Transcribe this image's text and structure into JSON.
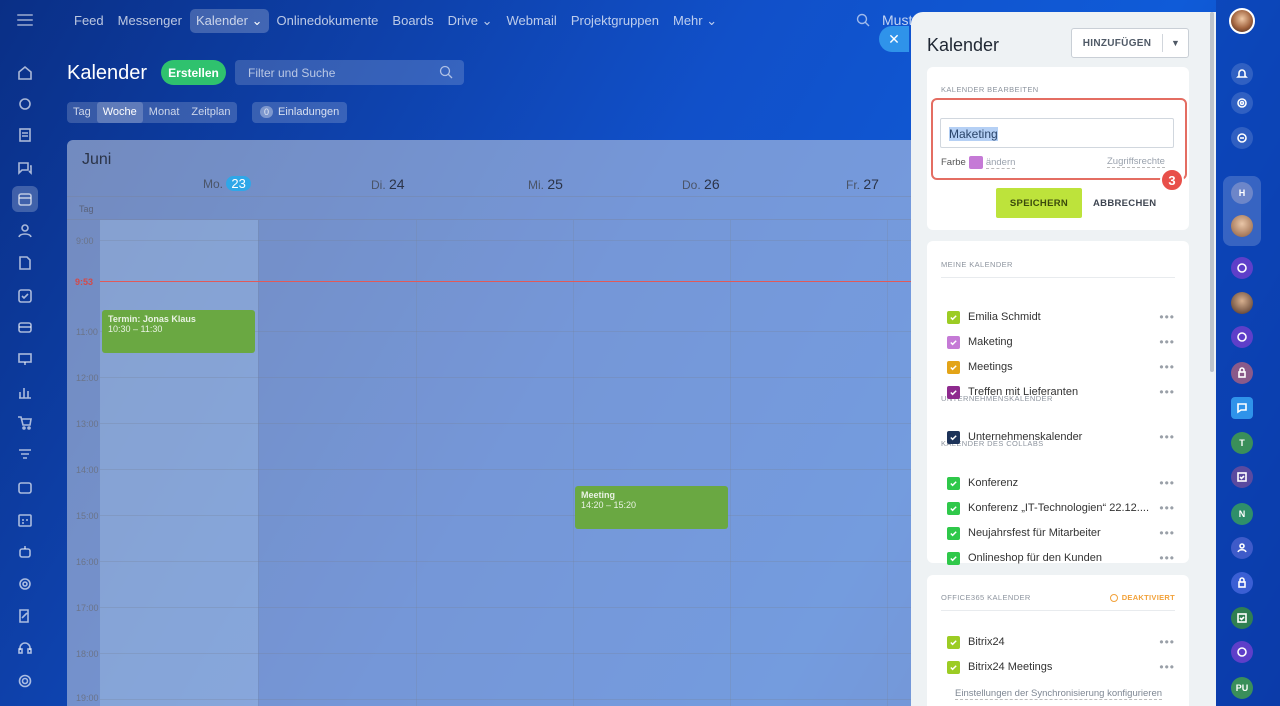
{
  "topbar": {
    "nav": [
      "Feed",
      "Messenger",
      "Kalender",
      "Onlinedokumente",
      "Boards",
      "Drive",
      "Webmail",
      "Projektgruppen",
      "Mehr"
    ],
    "search_text": "Must"
  },
  "calendar": {
    "title": "Kalender",
    "create_label": "Erstellen",
    "filter_placeholder": "Filter und Suche",
    "views": [
      "Tag",
      "Woche",
      "Monat",
      "Zeitplan"
    ],
    "invitations_count": "0",
    "invitations_label": "Einladungen",
    "month": "Juni",
    "days": [
      {
        "name": "Mo.",
        "num": "23"
      },
      {
        "name": "Di.",
        "num": "24"
      },
      {
        "name": "Mi.",
        "num": "25"
      },
      {
        "name": "Do.",
        "num": "26"
      },
      {
        "name": "Fr.",
        "num": "27"
      }
    ],
    "allday_label": "Tag",
    "times": [
      "9:00",
      "11:00",
      "12:00",
      "13:00",
      "14:00",
      "15:00",
      "16:00",
      "17:00",
      "18:00",
      "19:00"
    ],
    "now_time": "9:53",
    "events": [
      {
        "title": "Termin: Jonas Klaus",
        "time": "10:30 – 11:30"
      },
      {
        "title": "Meeting",
        "time": "14:20 – 15:20"
      }
    ]
  },
  "panel": {
    "title": "Kalender",
    "add_label": "HINZUFÜGEN",
    "edit": {
      "header": "KALENDER BEARBEITEN",
      "name_value": "Maketing",
      "color_label": "Farbe",
      "color_change": "ändern",
      "access_label": "Zugriffsrechte",
      "save_label": "SPEICHERN",
      "cancel_label": "ABBRECHEN",
      "step_badge": "3",
      "color": "#c57ad6"
    },
    "my_calendars": {
      "header": "MEINE KALENDER",
      "items": [
        {
          "name": "Emilia Schmidt",
          "color": "#9ccc24"
        },
        {
          "name": "Maketing",
          "color": "#c57ad6"
        },
        {
          "name": "Meetings",
          "color": "#e3a418"
        },
        {
          "name": "Treffen mit Lieferanten",
          "color": "#8e2a8e"
        }
      ],
      "company_header": "UNTERNEHMENSKALENDER",
      "company_items": [
        {
          "name": "Unternehmenskalender",
          "color": "#1d3359"
        }
      ],
      "collab_header": "KALENDER DES COLLABS",
      "collab_items": [
        {
          "name": "Konferenz",
          "color": "#2fc84a"
        },
        {
          "name": "Konferenz „IT-Technologien“ 22.12....",
          "color": "#2fc84a"
        },
        {
          "name": "Neujahrsfest für Mitarbeiter",
          "color": "#2fc84a"
        },
        {
          "name": "Onlineshop für den Kunden",
          "color": "#2fc84a"
        }
      ]
    },
    "office365": {
      "header": "OFFICE365 KALENDER",
      "status": "DEAKTIVIERT",
      "items": [
        {
          "name": "Bitrix24",
          "color": "#9ccc24"
        },
        {
          "name": "Bitrix24 Meetings",
          "color": "#9ccc24"
        }
      ],
      "sync_link": "Einstellungen der Synchronisierung konfigurieren"
    }
  },
  "rightbar": {
    "initials": [
      "H",
      "T",
      "N",
      "PU"
    ]
  }
}
